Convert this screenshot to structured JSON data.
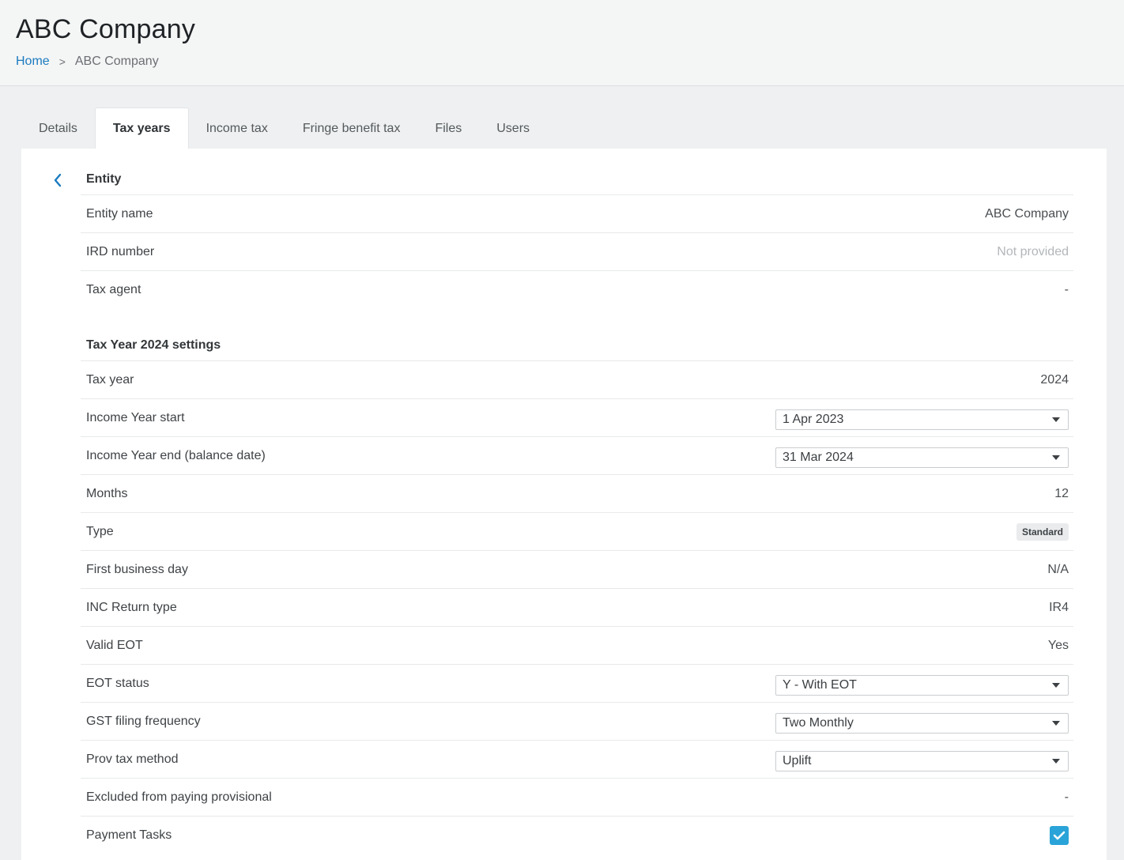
{
  "header": {
    "title": "ABC Company",
    "breadcrumb": {
      "home": "Home",
      "separator": ">",
      "current": "ABC Company"
    }
  },
  "tabs": [
    {
      "label": "Details"
    },
    {
      "label": "Tax years"
    },
    {
      "label": "Income tax"
    },
    {
      "label": "Fringe benefit tax"
    },
    {
      "label": "Files"
    },
    {
      "label": "Users"
    }
  ],
  "active_tab": "Tax years",
  "entity": {
    "title": "Entity",
    "rows": [
      {
        "label": "Entity name",
        "value": "ABC Company"
      },
      {
        "label": "IRD number",
        "value": "Not provided"
      },
      {
        "label": "Tax agent",
        "value": "-"
      }
    ]
  },
  "settings": {
    "title": "Tax Year 2024 settings",
    "tax_year": {
      "label": "Tax year",
      "value": "2024"
    },
    "income_year_start": {
      "label": "Income Year start",
      "value": "1 Apr 2023"
    },
    "income_year_end": {
      "label": "Income Year end (balance date)",
      "value": "31 Mar 2024"
    },
    "months": {
      "label": "Months",
      "value": "12"
    },
    "type": {
      "label": "Type",
      "value": "Standard"
    },
    "first_business_day": {
      "label": "First business day",
      "value": "N/A"
    },
    "inc_return_type": {
      "label": "INC Return type",
      "value": "IR4"
    },
    "valid_eot": {
      "label": "Valid EOT",
      "value": "Yes"
    },
    "eot_status": {
      "label": "EOT status",
      "value": "Y - With EOT"
    },
    "gst_filing_frequency": {
      "label": "GST filing frequency",
      "value": "Two Monthly"
    },
    "prov_tax_method": {
      "label": "Prov tax method",
      "value": "Uplift"
    },
    "excluded_from_provisional": {
      "label": "Excluded from paying provisional",
      "value": "-"
    },
    "payment_tasks": {
      "label": "Payment Tasks",
      "checked": true
    }
  },
  "colors": {
    "accent": "#2aa3d8",
    "link": "#1a7bbf"
  },
  "icons": {
    "back": "chevron-left-icon",
    "dropdown": "caret-down-icon",
    "check": "checkmark-icon"
  }
}
